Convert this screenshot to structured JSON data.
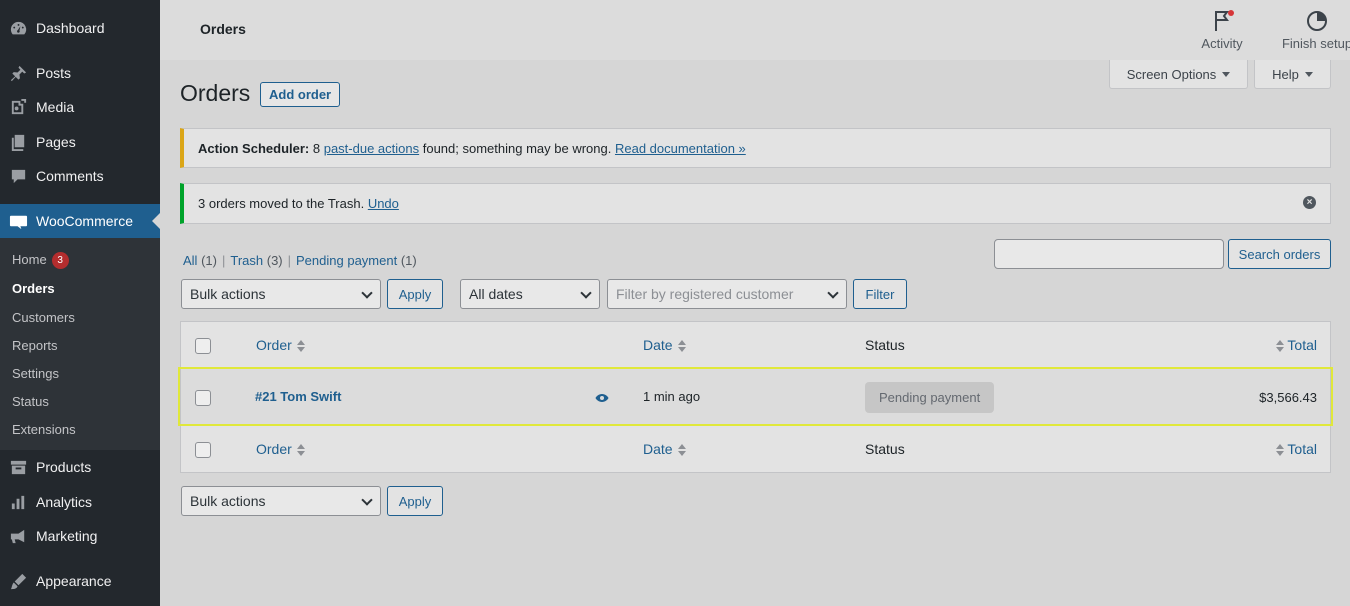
{
  "sidebar": {
    "items": [
      {
        "label": "Dashboard",
        "icon": "dashboard-icon"
      },
      {
        "label": "Posts",
        "icon": "pushpin-icon"
      },
      {
        "label": "Media",
        "icon": "media-icon"
      },
      {
        "label": "Pages",
        "icon": "pages-icon"
      },
      {
        "label": "Comments",
        "icon": "comment-icon"
      },
      {
        "label": "WooCommerce",
        "icon": "woocommerce-icon"
      },
      {
        "label": "Products",
        "icon": "archive-icon"
      },
      {
        "label": "Analytics",
        "icon": "bar-chart-icon"
      },
      {
        "label": "Marketing",
        "icon": "megaphone-icon"
      },
      {
        "label": "Appearance",
        "icon": "paintbrush-icon"
      }
    ],
    "submenu": [
      {
        "label": "Home",
        "badge": "3"
      },
      {
        "label": "Orders"
      },
      {
        "label": "Customers"
      },
      {
        "label": "Reports"
      },
      {
        "label": "Settings"
      },
      {
        "label": "Status"
      },
      {
        "label": "Extensions"
      }
    ]
  },
  "topbar": {
    "title": "Orders",
    "activity_label": "Activity",
    "finish_setup_label": "Finish setup"
  },
  "screen_options": {
    "label": "Screen Options",
    "help_label": "Help"
  },
  "page": {
    "title": "Orders",
    "add_order_label": "Add order"
  },
  "notices": {
    "scheduler": {
      "strong": "Action Scheduler:",
      "text_before": " 8 ",
      "link1": "past-due actions",
      "text_after": " found; something may be wrong. ",
      "link2": "Read documentation »"
    },
    "trash": {
      "text": "3 orders moved to the Trash. ",
      "undo": "Undo"
    }
  },
  "views": [
    {
      "label": "All",
      "count": "(1)"
    },
    {
      "label": "Trash",
      "count": "(3)"
    },
    {
      "label": "Pending payment",
      "count": "(1)"
    }
  ],
  "search": {
    "value": "",
    "button": "Search orders"
  },
  "filters": {
    "bulk_actions": "Bulk actions",
    "apply": "Apply",
    "dates": "All dates",
    "customer_placeholder": "Filter by registered customer",
    "filter_button": "Filter"
  },
  "table": {
    "columns": {
      "order": "Order",
      "date": "Date",
      "status": "Status",
      "total": "Total"
    },
    "rows": [
      {
        "order": "#21 Tom Swift",
        "date": "1 min ago",
        "status": "Pending payment",
        "total": "$3,566.43"
      }
    ]
  },
  "bottom": {
    "bulk_actions": "Bulk actions",
    "apply": "Apply"
  },
  "colors": {
    "accent": "#1f5f8f",
    "sidebar": "#23282d",
    "warning": "#dba617",
    "success": "#00a32a",
    "highlight": "#e0e83a"
  }
}
